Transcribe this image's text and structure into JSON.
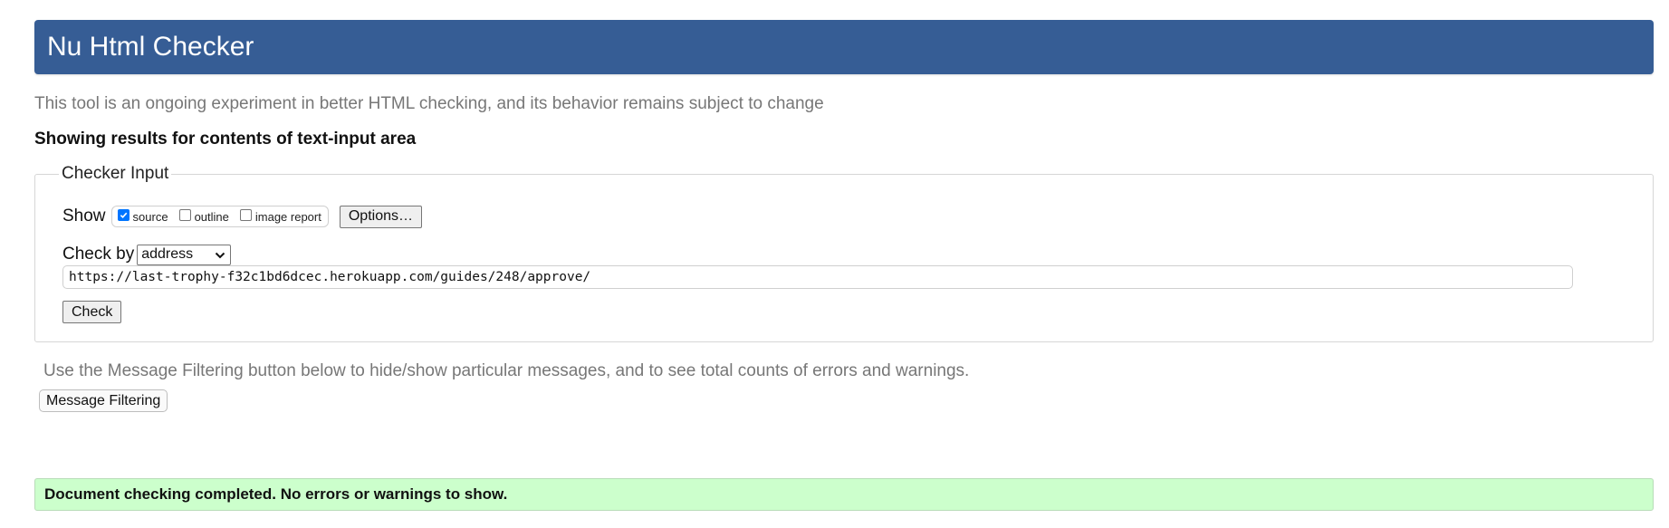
{
  "header": {
    "title": "Nu Html Checker",
    "color": "#365d95"
  },
  "intro": "This tool is an ongoing experiment in better HTML checking, and its behavior remains subject to change",
  "showing_results": "Showing results for contents of text-input area",
  "checker_input": {
    "legend": "Checker Input",
    "show_label": "Show",
    "show_options": [
      {
        "label": "source",
        "checked": true
      },
      {
        "label": "outline",
        "checked": false
      },
      {
        "label": "image report",
        "checked": false
      }
    ],
    "options_button": "Options…",
    "check_by_label": "Check by",
    "check_by_selected": "address",
    "url_value": "https://last-trophy-f32c1bd6dcec.herokuapp.com/guides/248/approve/",
    "check_button": "Check"
  },
  "filtering": {
    "text": "Use the Message Filtering button below to hide/show particular messages, and to see total counts of errors and warnings.",
    "button": "Message Filtering"
  },
  "result": {
    "message": "Document checking completed. No errors or warnings to show.",
    "color": "#ccffcc"
  }
}
